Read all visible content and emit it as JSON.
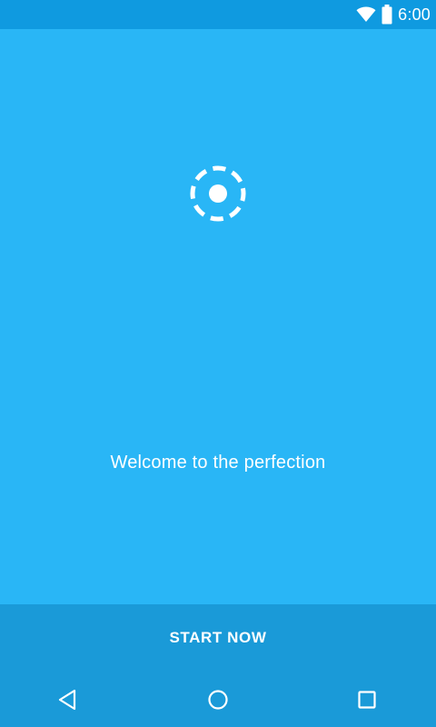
{
  "status_bar": {
    "time": "6:00",
    "icons": [
      "wifi-icon",
      "battery-icon"
    ]
  },
  "main": {
    "logo_icon": "dashed-circle-dot-icon",
    "welcome_text": "Welcome to the perfection"
  },
  "bottom": {
    "start_label": "START NOW"
  },
  "nav_bar": {
    "icons": [
      "back-icon",
      "home-icon",
      "recents-icon"
    ]
  },
  "colors": {
    "background": "#29b6f6",
    "status_bar": "#0f9ae0",
    "bottom_bar": "#1a9ad8",
    "foreground": "#ffffff"
  }
}
